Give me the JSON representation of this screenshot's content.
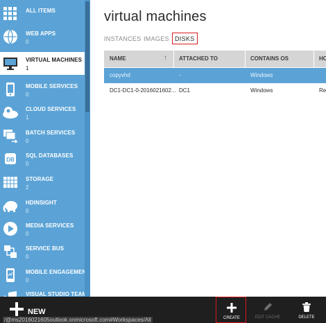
{
  "sidebar": {
    "items": [
      {
        "label": "ALL ITEMS",
        "count": "",
        "icon": "grid-icon"
      },
      {
        "label": "WEB APPS",
        "count": "0",
        "icon": "globe-icon"
      },
      {
        "label": "VIRTUAL MACHINES",
        "count": "1",
        "icon": "monitor-icon"
      },
      {
        "label": "MOBILE SERVICES",
        "count": "0",
        "icon": "phone-icon"
      },
      {
        "label": "CLOUD SERVICES",
        "count": "1",
        "icon": "gear-cloud-icon"
      },
      {
        "label": "BATCH SERVICES",
        "count": "0",
        "icon": "batch-icon"
      },
      {
        "label": "SQL DATABASES",
        "count": "0",
        "icon": "database-icon"
      },
      {
        "label": "STORAGE",
        "count": "2",
        "icon": "storage-icon"
      },
      {
        "label": "HDINSIGHT",
        "count": "0",
        "icon": "elephant-icon"
      },
      {
        "label": "MEDIA SERVICES",
        "count": "0",
        "icon": "media-icon"
      },
      {
        "label": "SERVICE BUS",
        "count": "0",
        "icon": "service-bus-icon"
      },
      {
        "label": "MOBILE ENGAGEMENT",
        "count": "0",
        "icon": "engagement-icon"
      },
      {
        "label": "VISUAL STUDIO TEAM S...",
        "count": "",
        "icon": "visual-studio-icon"
      }
    ]
  },
  "page": {
    "title": "virtual machines",
    "tabs": [
      "INSTANCES",
      "IMAGES",
      "DISKS"
    ],
    "active_tab": "DISKS"
  },
  "table": {
    "columns": [
      "NAME",
      "ATTACHED TO",
      "CONTAINS OS",
      "HO"
    ],
    "rows": [
      {
        "name": "copyvhd",
        "attached_to": "-",
        "contains_os": "Windows",
        "host": ""
      },
      {
        "name": "DC1-DC1-0-2016021602...",
        "attached_to": "DC1",
        "contains_os": "Windows",
        "host": "Re"
      }
    ],
    "selected_row": 0
  },
  "bottombar": {
    "new_label": "NEW",
    "status_url": "/@ms2016021605outlook.onmicrosoft.com#Workspaces/All",
    "commands": [
      {
        "label": "CREATE",
        "icon": "plus-icon",
        "enabled": true
      },
      {
        "label": "EDIT CACHE",
        "icon": "pencil-icon",
        "enabled": false
      },
      {
        "label": "DELETE",
        "icon": "trash-icon",
        "enabled": true
      }
    ]
  },
  "colors": {
    "sidebar": "#5ba3d6",
    "selected_row": "#5ba3d6",
    "bottombar": "#1f1f1f",
    "highlight": "#d7191c"
  }
}
